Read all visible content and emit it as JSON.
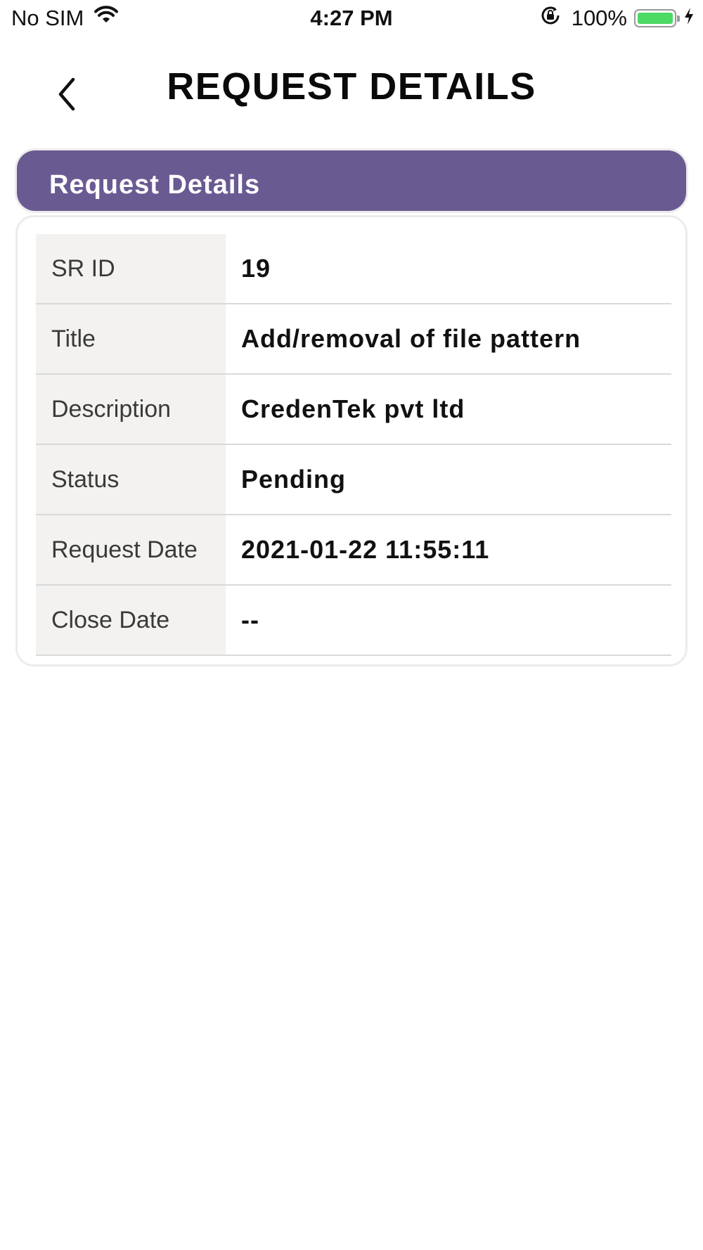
{
  "status_bar": {
    "carrier": "No SIM",
    "time": "4:27 PM",
    "battery_percent": "100%",
    "battery_level": 1.0,
    "battery_color": "#4cd964"
  },
  "nav": {
    "title": "REQUEST DETAILS",
    "back_icon": "chevron-left-icon"
  },
  "card": {
    "header": "Request Details",
    "header_color": "#6a5a92",
    "rows": [
      {
        "label": "SR ID",
        "value": "19"
      },
      {
        "label": "Title",
        "value": "Add/removal of file pattern"
      },
      {
        "label": "Description",
        "value": "CredenTek pvt ltd"
      },
      {
        "label": "Status",
        "value": "Pending"
      },
      {
        "label": "Request Date",
        "value": "2021-01-22 11:55:11"
      },
      {
        "label": "Close Date",
        "value": "--"
      }
    ]
  }
}
